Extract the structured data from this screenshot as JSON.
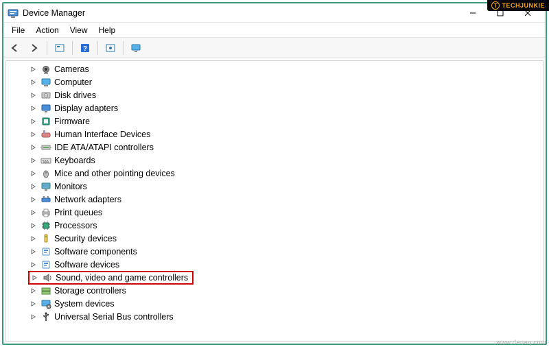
{
  "window": {
    "title": "Device Manager"
  },
  "menu": {
    "file": "File",
    "action": "Action",
    "view": "View",
    "help": "Help"
  },
  "watermark": {
    "text": "TECHJUNKIE",
    "site": "www.deuaq.com"
  },
  "tree": {
    "items": [
      {
        "label": "Cameras",
        "icon": "camera"
      },
      {
        "label": "Computer",
        "icon": "computer"
      },
      {
        "label": "Disk drives",
        "icon": "disk"
      },
      {
        "label": "Display adapters",
        "icon": "display"
      },
      {
        "label": "Firmware",
        "icon": "firmware"
      },
      {
        "label": "Human Interface Devices",
        "icon": "hid"
      },
      {
        "label": "IDE ATA/ATAPI controllers",
        "icon": "ide"
      },
      {
        "label": "Keyboards",
        "icon": "keyboard"
      },
      {
        "label": "Mice and other pointing devices",
        "icon": "mouse"
      },
      {
        "label": "Monitors",
        "icon": "monitor"
      },
      {
        "label": "Network adapters",
        "icon": "network"
      },
      {
        "label": "Print queues",
        "icon": "printer"
      },
      {
        "label": "Processors",
        "icon": "cpu"
      },
      {
        "label": "Security devices",
        "icon": "security"
      },
      {
        "label": "Software components",
        "icon": "software"
      },
      {
        "label": "Software devices",
        "icon": "software"
      },
      {
        "label": "Sound, video and game controllers",
        "icon": "sound",
        "highlighted": true
      },
      {
        "label": "Storage controllers",
        "icon": "storage"
      },
      {
        "label": "System devices",
        "icon": "system"
      },
      {
        "label": "Universal Serial Bus controllers",
        "icon": "usb"
      }
    ]
  }
}
